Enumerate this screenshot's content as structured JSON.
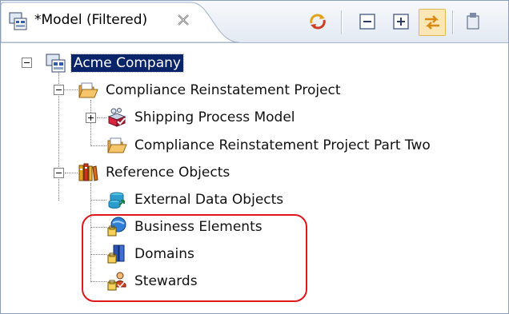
{
  "view": {
    "tab_title": "*Model (Filtered)",
    "tab_icon": "model-icon",
    "close_icon": "close-icon",
    "toolbar": [
      {
        "name": "sync-icon",
        "tooltip": ""
      },
      {
        "name": "collapse-all-icon"
      },
      {
        "name": "expand-all-icon"
      },
      {
        "name": "link-with-editor-icon"
      },
      {
        "name": "menu-icon"
      }
    ]
  },
  "tree": {
    "root": {
      "label": "Acme Company",
      "icon": "model-icon",
      "selected": true
    },
    "project": {
      "label": "Compliance Reinstatement  Project",
      "icon": "folder-icon"
    },
    "shipping": {
      "label": "Shipping Process Model",
      "icon": "process-model-icon"
    },
    "project_two": {
      "label": "Compliance Reinstatement Project Part Two",
      "icon": "folder-icon"
    },
    "reference": {
      "label": "Reference Objects",
      "icon": "library-icon"
    },
    "external": {
      "label": "External Data Objects",
      "icon": "external-data-icon"
    },
    "business": {
      "label": "Business Elements",
      "icon": "business-elements-icon"
    },
    "domains": {
      "label": "Domains",
      "icon": "domains-icon"
    },
    "stewards": {
      "label": "Stewards",
      "icon": "stewards-icon"
    }
  },
  "colors": {
    "selection": "#0a246a",
    "highlight_box": "#e0161b"
  }
}
